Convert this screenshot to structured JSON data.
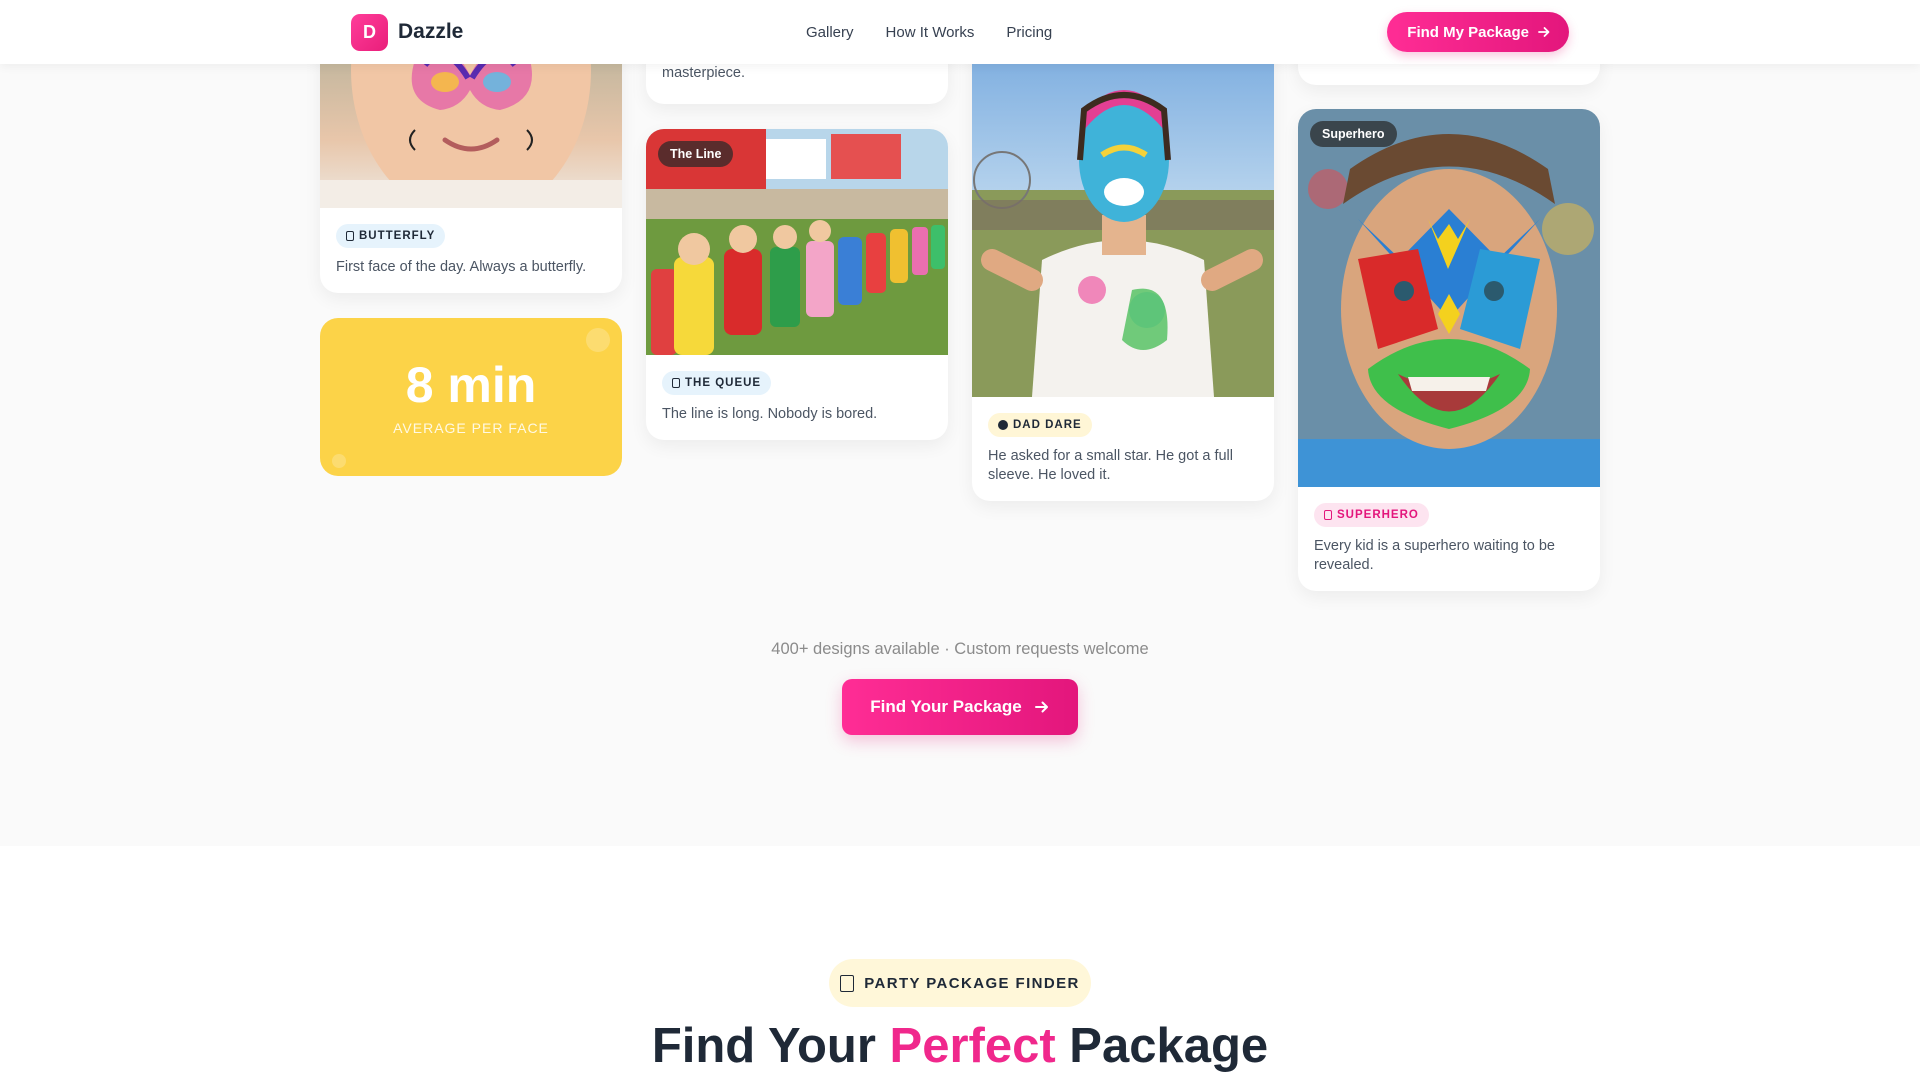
{
  "header": {
    "logo_letter": "D",
    "brand": "Dazzle",
    "nav": [
      "Gallery",
      "How It Works",
      "Pricing"
    ],
    "cta": "Find My Package"
  },
  "gallery": {
    "partial_caption": "masterpiece.",
    "cards": [
      {
        "tag": "BUTTERFLY",
        "text": "First face of the day. Always a butterfly."
      },
      {
        "image_label": "The Line",
        "tag": "THE QUEUE",
        "text": "The line is long. Nobody is bored."
      },
      {
        "tag": "DAD DARE",
        "text": "He asked for a small star. He got a full sleeve. He loved it."
      },
      {
        "image_label": "Superhero",
        "tag": "SUPERHERO",
        "text": "Every kid is a superhero waiting to be revealed."
      }
    ],
    "stat": {
      "value": "8 min",
      "label": "AVERAGE PER FACE"
    }
  },
  "cta_section": {
    "designs_line": "400+ designs available · Custom requests welcome",
    "button": "Find Your Package"
  },
  "finder": {
    "badge": "PARTY PACKAGE FINDER",
    "title_start": "Find Your ",
    "title_highlight": "Perfect",
    "title_end": " Package"
  },
  "colors": {
    "accent": "#e91e7a",
    "stat_yellow": "#fcd348"
  }
}
